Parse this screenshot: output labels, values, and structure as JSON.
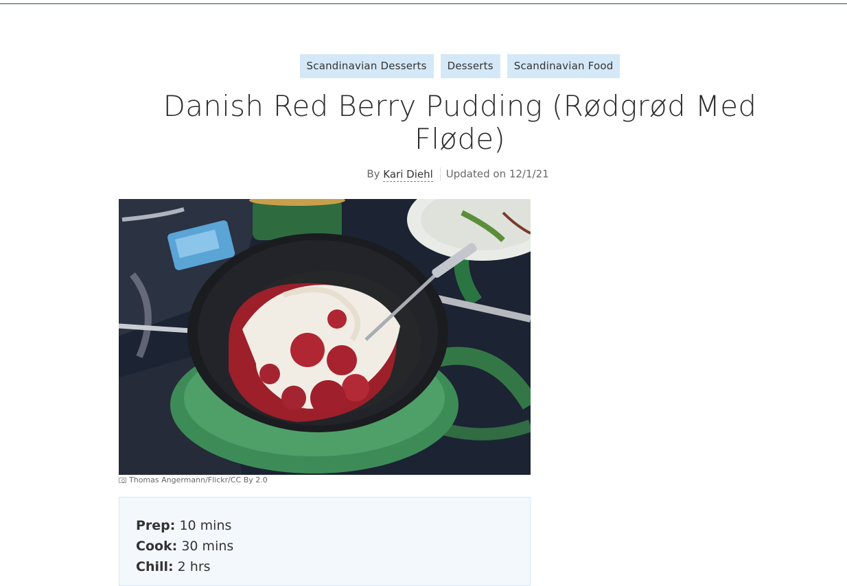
{
  "tags": [
    "Scandinavian Desserts",
    "Desserts",
    "Scandinavian Food"
  ],
  "title": "Danish Red Berry Pudding (Rødgrød Med Fløde)",
  "byline": {
    "by": "By",
    "author": "Kari Diehl",
    "updated": "Updated on 12/1/21"
  },
  "photo_credit": "Thomas Angermann/Flickr/CC By 2.0",
  "recipe_meta": [
    {
      "label": "Prep:",
      "value": "10 mins"
    },
    {
      "label": "Cook:",
      "value": "30 mins"
    },
    {
      "label": "Chill:",
      "value": "2 hrs"
    }
  ],
  "colors": {
    "tag_bg": "#d4e8f7",
    "meta_bg": "#f3f8fc",
    "author_underline": "#19a5a5"
  }
}
